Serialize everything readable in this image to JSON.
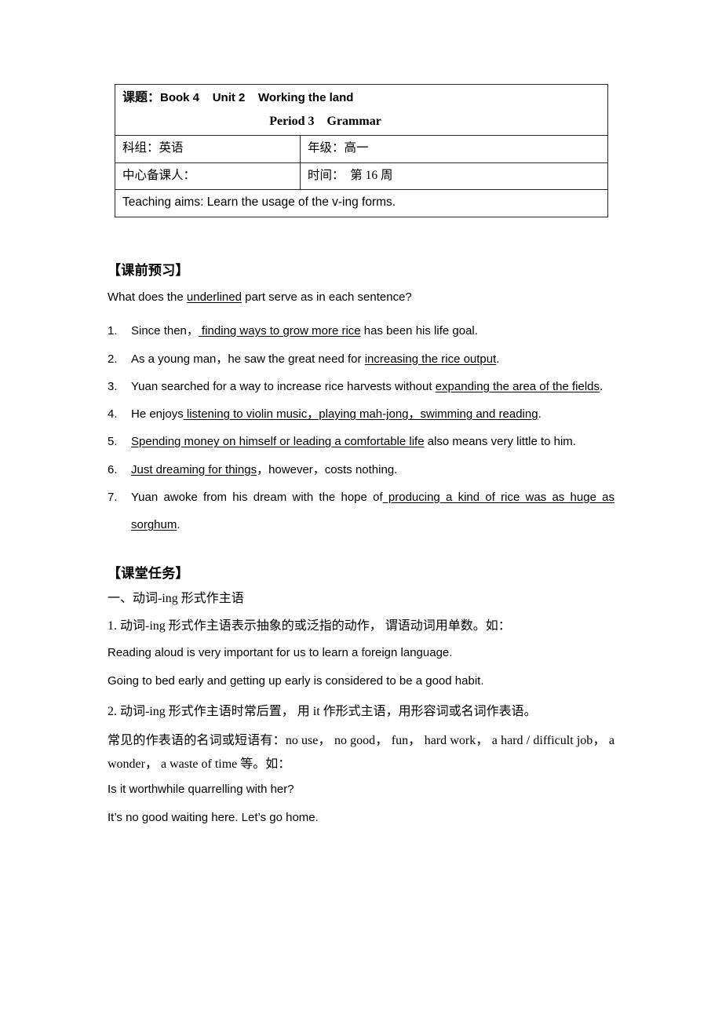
{
  "header_table": {
    "topic_label": "课题：",
    "topic_text": "Book 4    Unit 2    Working the land",
    "topic_line2": "Period 3    Grammar",
    "subject_cell": "科组：英语",
    "grade_cell": "年级：高一",
    "preparer_cell": "中心备课人：",
    "time_cell": "时间：  第 16 周",
    "teaching_aims": "Teaching aims: Learn the usage of the v-ing forms."
  },
  "preview": {
    "heading": "【课前预习】",
    "instruction_a": "What does the ",
    "instruction_underlined": "underlined",
    "instruction_b": " part serve as in each sentence?",
    "items": [
      {
        "num": "1.",
        "pre": "Since then，",
        "underlined": " finding ways to grow more rice",
        "post": " has been his life goal."
      },
      {
        "num": "2.",
        "pre": "As a young man，he saw the great need for ",
        "underlined": "increasing the rice output",
        "post": "."
      },
      {
        "num": "3.",
        "pre": "Yuan searched for a way to increase rice harvests without ",
        "underlined": "expanding the area of the fields",
        "post": "."
      },
      {
        "num": "4.",
        "pre": "He enjoys",
        "underlined": " listening to violin music，playing mah-jong，swimming and reading",
        "post": "."
      },
      {
        "num": "5.",
        "pre": "",
        "underlined": "Spending money on himself or leading a comfortable life",
        "post": " also means very little to him."
      },
      {
        "num": "6.",
        "pre": "",
        "underlined": "Just dreaming for things",
        "post": "，however，costs nothing."
      },
      {
        "num": "7.",
        "pre": "Yuan awoke from his dream with the hope of",
        "underlined": " producing a kind of rice was as huge as sorghum",
        "post": "."
      }
    ]
  },
  "task": {
    "heading": "【课堂任务】",
    "subheading": "一、动词-ing 形式作主语",
    "point1": "1. 动词-ing 形式作主语表示抽象的或泛指的动作， 谓语动词用单数。如：",
    "example1": "Reading aloud is very important for us to learn a foreign language.",
    "example2": "Going to bed early and getting up early is considered to be a good habit.",
    "point2_line1": "2. 动词-ing 形式作主语时常后置， 用 it 作形式主语，用形容词或名词作表语。",
    "point2_line2": "常见的作表语的名词或短语有：no use， no good， fun， hard work， a hard / difficult job， a wonder， a waste of time 等。如：",
    "example3": "Is it worthwhile quarrelling with her?",
    "example4": "It’s no good waiting here. Let’s go home."
  }
}
